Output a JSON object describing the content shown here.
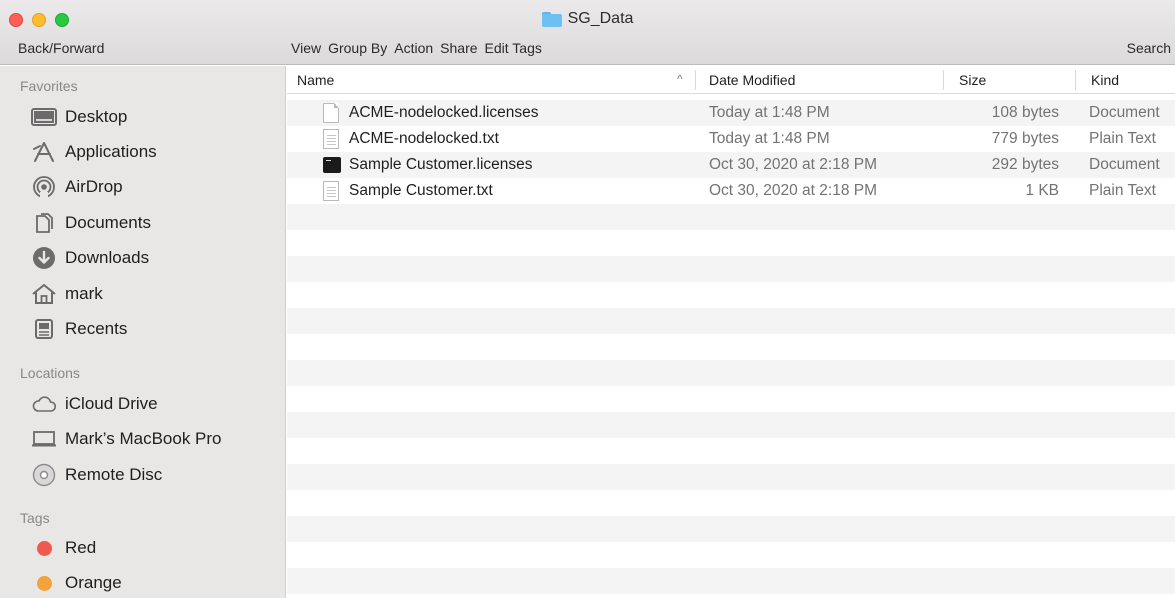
{
  "window": {
    "title": "SG_Data",
    "folder_icon": "folder-icon"
  },
  "toolbar": {
    "back_forward": "Back/Forward",
    "view": "View",
    "group_by": "Group By",
    "action": "Action",
    "share": "Share",
    "edit_tags": "Edit Tags",
    "search": "Search"
  },
  "sidebar": {
    "favorites_header": "Favorites",
    "favorites": [
      {
        "label": "Desktop",
        "icon": "desktop-icon"
      },
      {
        "label": "Applications",
        "icon": "applications-icon"
      },
      {
        "label": "AirDrop",
        "icon": "airdrop-icon"
      },
      {
        "label": "Documents",
        "icon": "documents-icon"
      },
      {
        "label": "Downloads",
        "icon": "downloads-icon"
      },
      {
        "label": "mark",
        "icon": "home-icon"
      },
      {
        "label": "Recents",
        "icon": "recents-icon"
      }
    ],
    "locations_header": "Locations",
    "locations": [
      {
        "label": "iCloud Drive",
        "icon": "cloud-icon"
      },
      {
        "label": "Mark’s MacBook Pro",
        "icon": "laptop-icon"
      },
      {
        "label": "Remote Disc",
        "icon": "disc-icon"
      }
    ],
    "tags_header": "Tags",
    "tags": [
      {
        "label": "Red",
        "color": "#ee5a50"
      },
      {
        "label": "Orange",
        "color": "#f4a23d"
      }
    ]
  },
  "list": {
    "columns": {
      "name": "Name",
      "date_modified": "Date Modified",
      "size": "Size",
      "kind": "Kind"
    },
    "sort_indicator": "^",
    "files": [
      {
        "name": "ACME-nodelocked.licenses",
        "date": "Today at 1:48 PM",
        "size": "108 bytes",
        "kind": "Document",
        "icon": "document-icon"
      },
      {
        "name": "ACME-nodelocked.txt",
        "date": "Today at 1:48 PM",
        "size": "779 bytes",
        "kind": "Plain Text",
        "icon": "text-file-icon"
      },
      {
        "name": "Sample Customer.licenses",
        "date": "Oct 30, 2020 at 2:18 PM",
        "size": "292 bytes",
        "kind": "Document",
        "icon": "terminal-file-icon"
      },
      {
        "name": "Sample Customer.txt",
        "date": "Oct 30, 2020 at 2:18 PM",
        "size": "1 KB",
        "kind": "Plain Text",
        "icon": "text-file-icon"
      }
    ]
  }
}
